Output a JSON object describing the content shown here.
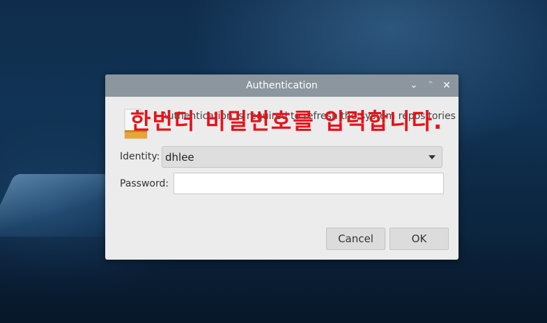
{
  "dialog": {
    "title": "Authentication",
    "message": "Authentication is required to refresh the system repositories",
    "overlay_annotation": "한번더 비밀번호를 입력합니다.",
    "identity_label": "Identity:",
    "identity_value": "dhlee",
    "password_label": "Password:",
    "password_value": "",
    "cancel_label": "Cancel",
    "ok_label": "OK",
    "titlebar_buttons": {
      "minimize": "⌄",
      "maximize": "⌃",
      "close": "✕"
    }
  },
  "colors": {
    "overlay_text": "#e8121a",
    "titlebar": "#8c969e",
    "dialog_bg": "#ececec"
  },
  "icons": [
    "chevron-down-icon",
    "chevron-up-icon",
    "close-icon",
    "file-icon",
    "dropdown-arrow-icon"
  ]
}
